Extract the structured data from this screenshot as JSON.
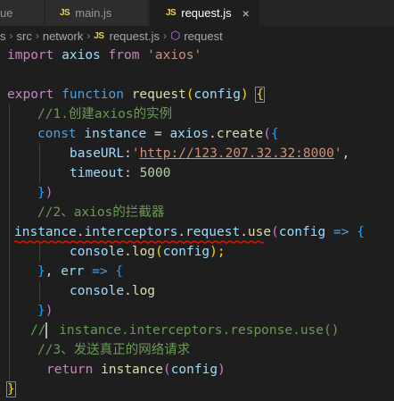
{
  "tabs": [
    {
      "label": "ue",
      "icon": "",
      "active": false
    },
    {
      "label": "main.js",
      "icon": "JS",
      "active": false
    },
    {
      "label": "request.js",
      "icon": "JS",
      "active": true,
      "close": "×"
    }
  ],
  "breadcrumb": {
    "segments": [
      "s",
      "src",
      "network"
    ],
    "file_icon": "JS",
    "file": "request.js",
    "symbol": "request"
  },
  "code": {
    "l1": [
      "import",
      " ",
      "axios",
      " ",
      "from",
      " ",
      "'axios'"
    ],
    "l3": [
      "export",
      " ",
      "function",
      " ",
      "request",
      "(",
      "config",
      ")",
      " ",
      "{"
    ],
    "l4": "//1.创建axios的实例",
    "l5": [
      "const",
      " ",
      "instance",
      " = ",
      "axios",
      ".",
      "create",
      "(",
      "{"
    ],
    "l6": [
      "baseURL",
      ":",
      "'",
      "http://123.207.32.32:8000",
      "'",
      ","
    ],
    "l7": [
      "timeout",
      ": ",
      "5000"
    ],
    "l8": [
      "}",
      ")"
    ],
    "l9": "//2、axios的拦截器",
    "l10": [
      "instance",
      ".",
      "interceptors",
      ".",
      "request",
      ".",
      "use",
      "(",
      "config",
      " ",
      "=>",
      " ",
      "{"
    ],
    "l11": [
      "console",
      ".",
      "log",
      "(",
      "config",
      ");"
    ],
    "l12": [
      "}",
      ", ",
      "err",
      " ",
      "=>",
      " ",
      "{"
    ],
    "l13": [
      "console",
      ".",
      "log"
    ],
    "l14": [
      "}",
      ")"
    ],
    "l15": [
      "//",
      " instance.interceptors.response.use()"
    ],
    "l16": "//3、发送真正的网络请求",
    "l17": [
      "return",
      " ",
      "instance",
      "(",
      "config",
      ")"
    ],
    "l18": "}"
  },
  "colors": {
    "background": "#1e1e1e",
    "keyword": "#569cd6",
    "control": "#c586c0",
    "function": "#dcdcaa",
    "variable": "#9cdcfe",
    "string": "#ce9178",
    "number": "#b5cea8",
    "comment": "#6a9955",
    "squiggle": "#e51400",
    "js_icon": "#e8d44d"
  }
}
